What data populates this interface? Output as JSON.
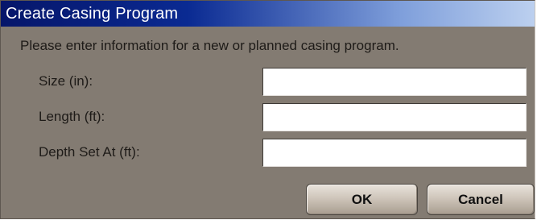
{
  "dialog": {
    "title": "Create Casing Program",
    "intro": "Please enter information for a new or planned casing program.",
    "fields": [
      {
        "label": "Size (in):",
        "value": ""
      },
      {
        "label": "Length (ft):",
        "value": ""
      },
      {
        "label": "Depth Set At (ft):",
        "value": ""
      }
    ],
    "buttons": {
      "ok": "OK",
      "cancel": "Cancel"
    }
  },
  "colors": {
    "dialog_background": "#837b72",
    "titlebar_start": "#06166a",
    "titlebar_end": "#bcd0ef",
    "input_background": "#ffffff"
  }
}
